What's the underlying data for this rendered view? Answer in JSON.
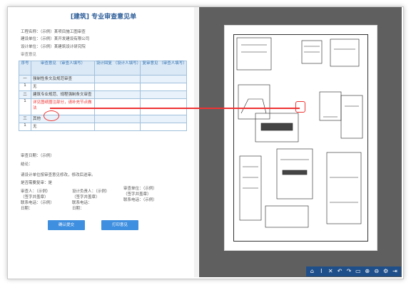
{
  "form": {
    "title": "[建筑] 专业审查意见单",
    "meta": [
      "工程名称：（示例）某项目施工图审查",
      "建设单位：（示例）某开发建设有限公司",
      "设计单位：（示例）某建筑设计研究院",
      "审查意见"
    ],
    "table": {
      "headers": [
        "序号",
        "审查意见\n（审查人填写）",
        "设计回复\n（设计人填写）",
        "复审意见\n（审查人填写）"
      ],
      "rows": [
        {
          "no": "一",
          "text": "强制性条文及规范审查",
          "section": true
        },
        {
          "no": "1",
          "text": "无",
          "section": false
        },
        {
          "no": "二",
          "text": "建筑专业规范、规程强制条文审查",
          "section": true
        },
        {
          "no": "1",
          "text": "详见图纸圈注部分，请补充节点做法",
          "section": false,
          "highlight": true
        },
        {
          "no": "三",
          "text": "其他",
          "section": true
        },
        {
          "no": "1",
          "text": "无",
          "section": false
        }
      ]
    },
    "after": [
      "审查日期：（示例）",
      "结论：",
      "请设计单位按审查意见修改，修改后送审。",
      "是否需要复审：是"
    ],
    "sig_left": [
      "审查人：（示例）",
      "（签字并盖章）",
      "联系电话：（示例）",
      "日期："
    ],
    "sig_mid": [
      "设计负责人：（示例）",
      "（签字并盖章）",
      "联系电话：",
      "日期："
    ],
    "sig_right": [
      "审查单位：（示例）",
      "（签字并盖章）",
      "联系电话：（示例）"
    ],
    "buttons": {
      "submit": "确认提交",
      "print": "打印意见"
    }
  },
  "pdf": {
    "toolbar": [
      "home-icon",
      "text-cursor-icon",
      "close-icon",
      "undo-icon",
      "redo-icon",
      "fit-icon",
      "zoom-in-icon",
      "zoom-out-icon",
      "settings-icon",
      "exit-icon"
    ]
  }
}
